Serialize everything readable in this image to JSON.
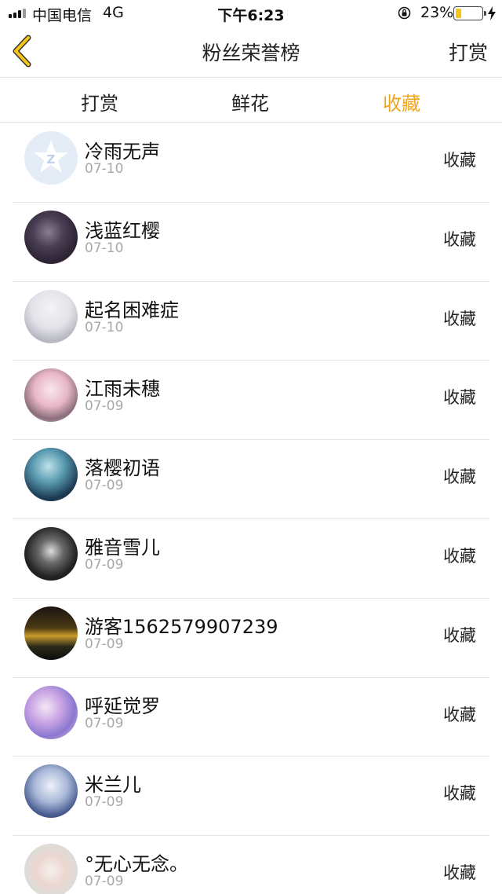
{
  "status_bar": {
    "carrier": "中国电信",
    "network": "4G",
    "time": "下午6:23",
    "battery_pct": "23%",
    "battery_level": 0.23,
    "icons": [
      "signal-icon",
      "orientation-lock-icon",
      "battery-icon",
      "charging-icon"
    ]
  },
  "nav": {
    "back_icon": "chevron-left-icon",
    "title": "粉丝荣誉榜",
    "right_label": "打赏"
  },
  "colors": {
    "accent": "#f0a520",
    "separator": "#e6e6e6",
    "muted_text": "#a8a8a8"
  },
  "tabs": [
    {
      "label": "打赏",
      "active": false
    },
    {
      "label": "鲜花",
      "active": false
    },
    {
      "label": "收藏",
      "active": true
    }
  ],
  "fans": [
    {
      "name": "冷雨无声",
      "date": "07-10",
      "action": "收藏"
    },
    {
      "name": "浅蓝红樱",
      "date": "07-10",
      "action": "收藏"
    },
    {
      "name": "起名困难症",
      "date": "07-10",
      "action": "收藏"
    },
    {
      "name": "江雨未穗",
      "date": "07-09",
      "action": "收藏"
    },
    {
      "name": "落樱初语",
      "date": "07-09",
      "action": "收藏"
    },
    {
      "name": "雅音雪儿",
      "date": "07-09",
      "action": "收藏"
    },
    {
      "name": "游客1562579907239",
      "date": "07-09",
      "action": "收藏"
    },
    {
      "name": "呼延觉罗",
      "date": "07-09",
      "action": "收藏"
    },
    {
      "name": "米兰儿",
      "date": "07-09",
      "action": "收藏"
    },
    {
      "name": "°无心无念。",
      "date": "07-09",
      "action": "收藏"
    }
  ]
}
